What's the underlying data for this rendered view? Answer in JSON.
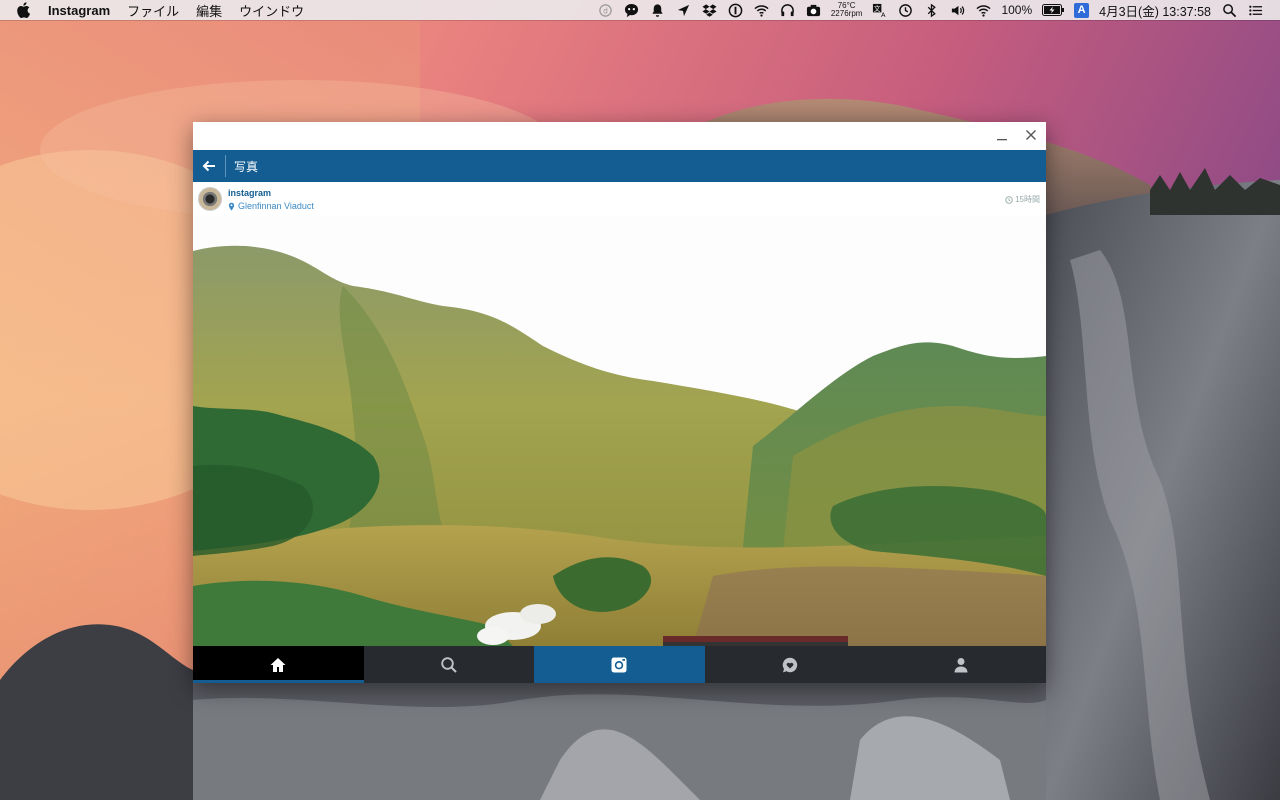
{
  "menubar": {
    "app_name": "Instagram",
    "menus": [
      "ファイル",
      "編集",
      "ウインドウ"
    ],
    "temp": "76°C",
    "rpm": "2276rpm",
    "battery": "100%",
    "input_method": "A",
    "datetime": "4月3日(金)  13:37:58"
  },
  "window": {
    "nav_title": "写真",
    "post": {
      "username": "instagram",
      "location": "Glenfinnan Viaduct",
      "time": "15時間"
    },
    "tabs": [
      "home-icon",
      "search-icon",
      "camera-icon",
      "activity-icon",
      "profile-icon"
    ]
  },
  "colors": {
    "nav_blue": "#135d92",
    "tabbar_dark": "#272a2f"
  }
}
